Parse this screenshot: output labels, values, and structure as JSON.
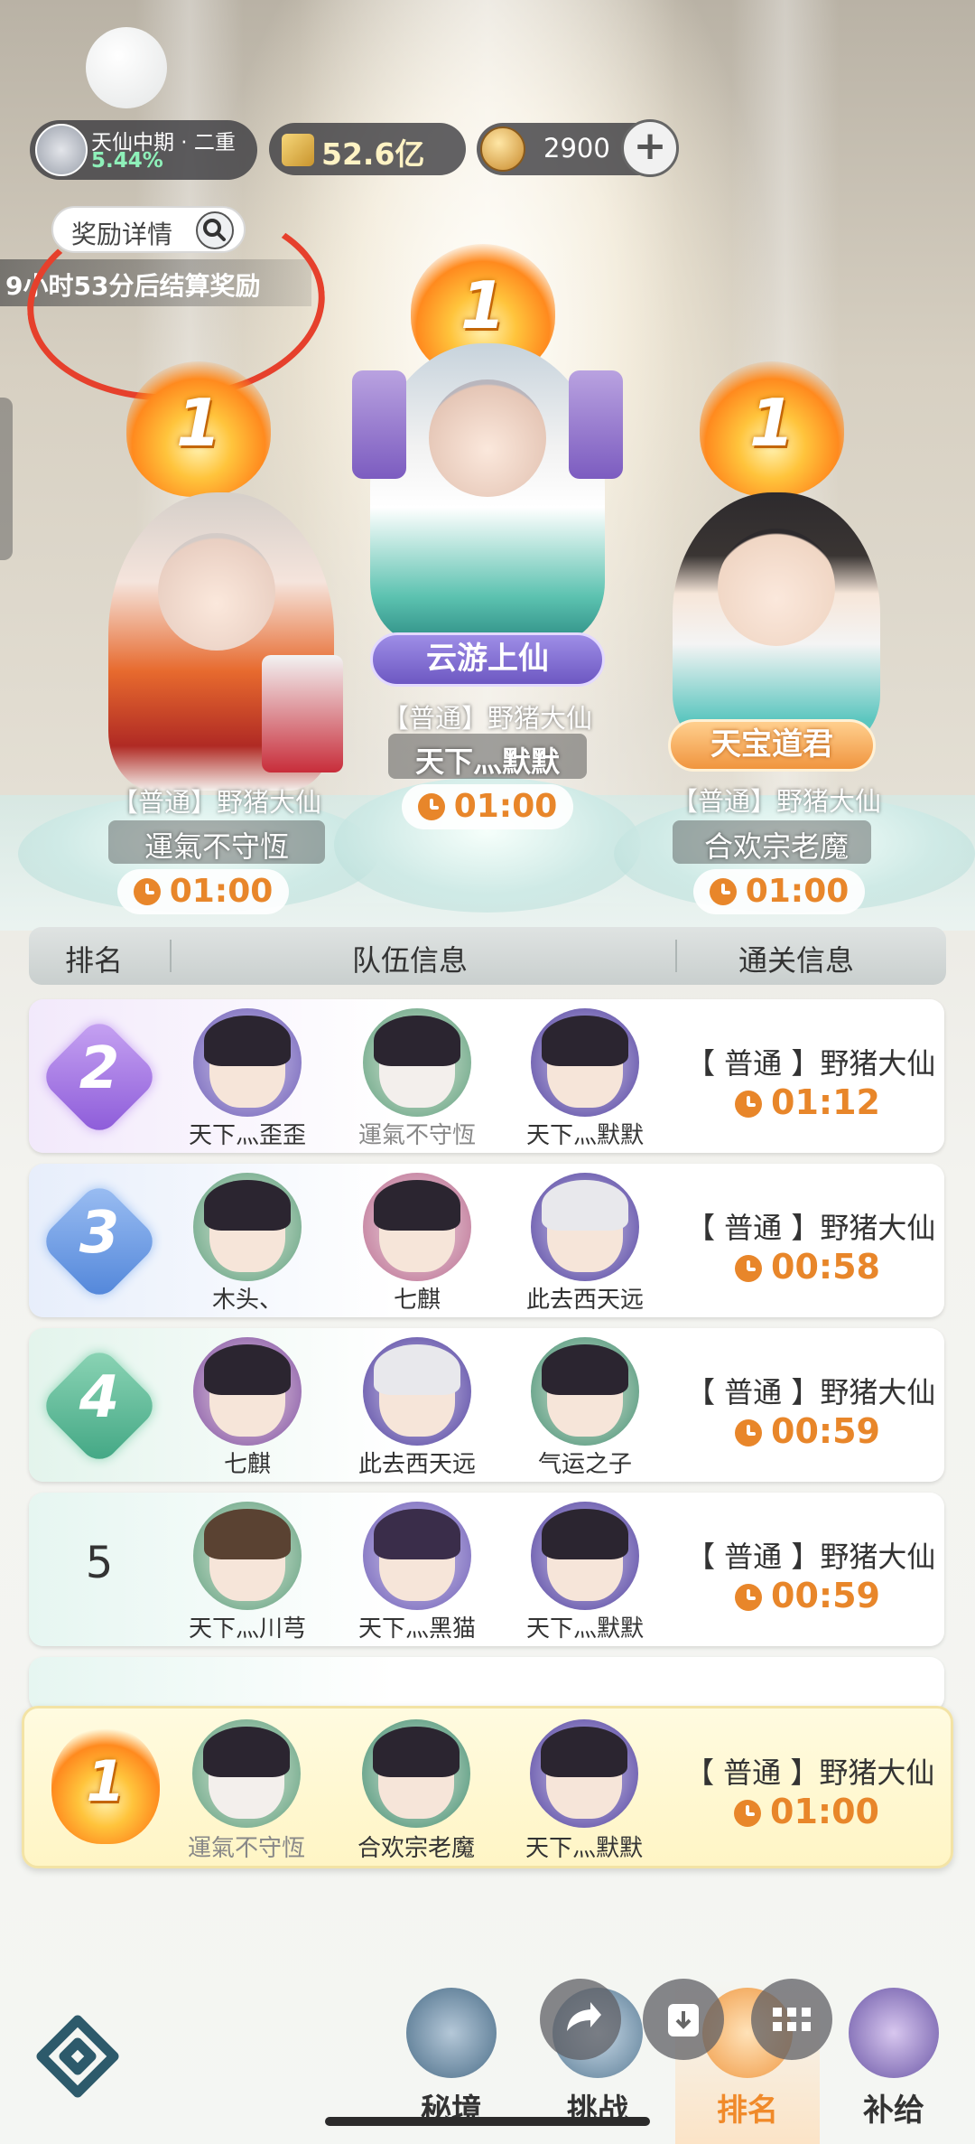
{
  "status": {
    "realm_title": "天仙中期 · 二重",
    "realm_progress": "5.44%",
    "power": "52.6亿",
    "coins": "2900"
  },
  "reward": {
    "details_label": "奖励详情",
    "countdown": "9小时53分后结算奖励"
  },
  "podium": [
    {
      "rank": "1",
      "title": "",
      "mode": "【普通】野猪大仙",
      "team": "運氣不守恆",
      "time": "01:00"
    },
    {
      "rank": "1",
      "title": "云游上仙",
      "mode": "【普通】野猪大仙",
      "team": "天下灬默默",
      "time": "01:00"
    },
    {
      "rank": "1",
      "title": "天宝道君",
      "mode": "【普通】野猪大仙",
      "team": "合欢宗老魔",
      "time": "01:00"
    }
  ],
  "table": {
    "headers": [
      "排名",
      "队伍信息",
      "通关信息"
    ],
    "rows": [
      {
        "rank": "2",
        "members": [
          "天下灬歪歪",
          "運氣不守恆",
          "天下灬默默"
        ],
        "mode": "【 普通 】野猪大仙",
        "time": "01:12"
      },
      {
        "rank": "3",
        "members": [
          "木头、",
          "七麒",
          "此去西天远"
        ],
        "mode": "【 普通 】野猪大仙",
        "time": "00:58"
      },
      {
        "rank": "4",
        "members": [
          "七麒",
          "此去西天远",
          "气运之子"
        ],
        "mode": "【 普通 】野猪大仙",
        "time": "00:59"
      },
      {
        "rank": "5",
        "members": [
          "天下灬川芎",
          "天下灬黑猫",
          "天下灬默默"
        ],
        "mode": "【 普通 】野猪大仙",
        "time": "00:59"
      }
    ],
    "my_row": {
      "rank": "1",
      "members": [
        "運氣不守恆",
        "合欢宗老魔",
        "天下灬默默"
      ],
      "mode": "【 普通 】野猪大仙",
      "time": "01:00"
    }
  },
  "nav": {
    "items": [
      "秘境",
      "挑战",
      "排名",
      "补给"
    ],
    "active": "排名"
  },
  "colors": {
    "accent_orange": "#e8862a",
    "annotation_red": "#e6402c",
    "rank2": "#a46be0",
    "rank3": "#4f84d9",
    "rank4": "#3fa582"
  }
}
